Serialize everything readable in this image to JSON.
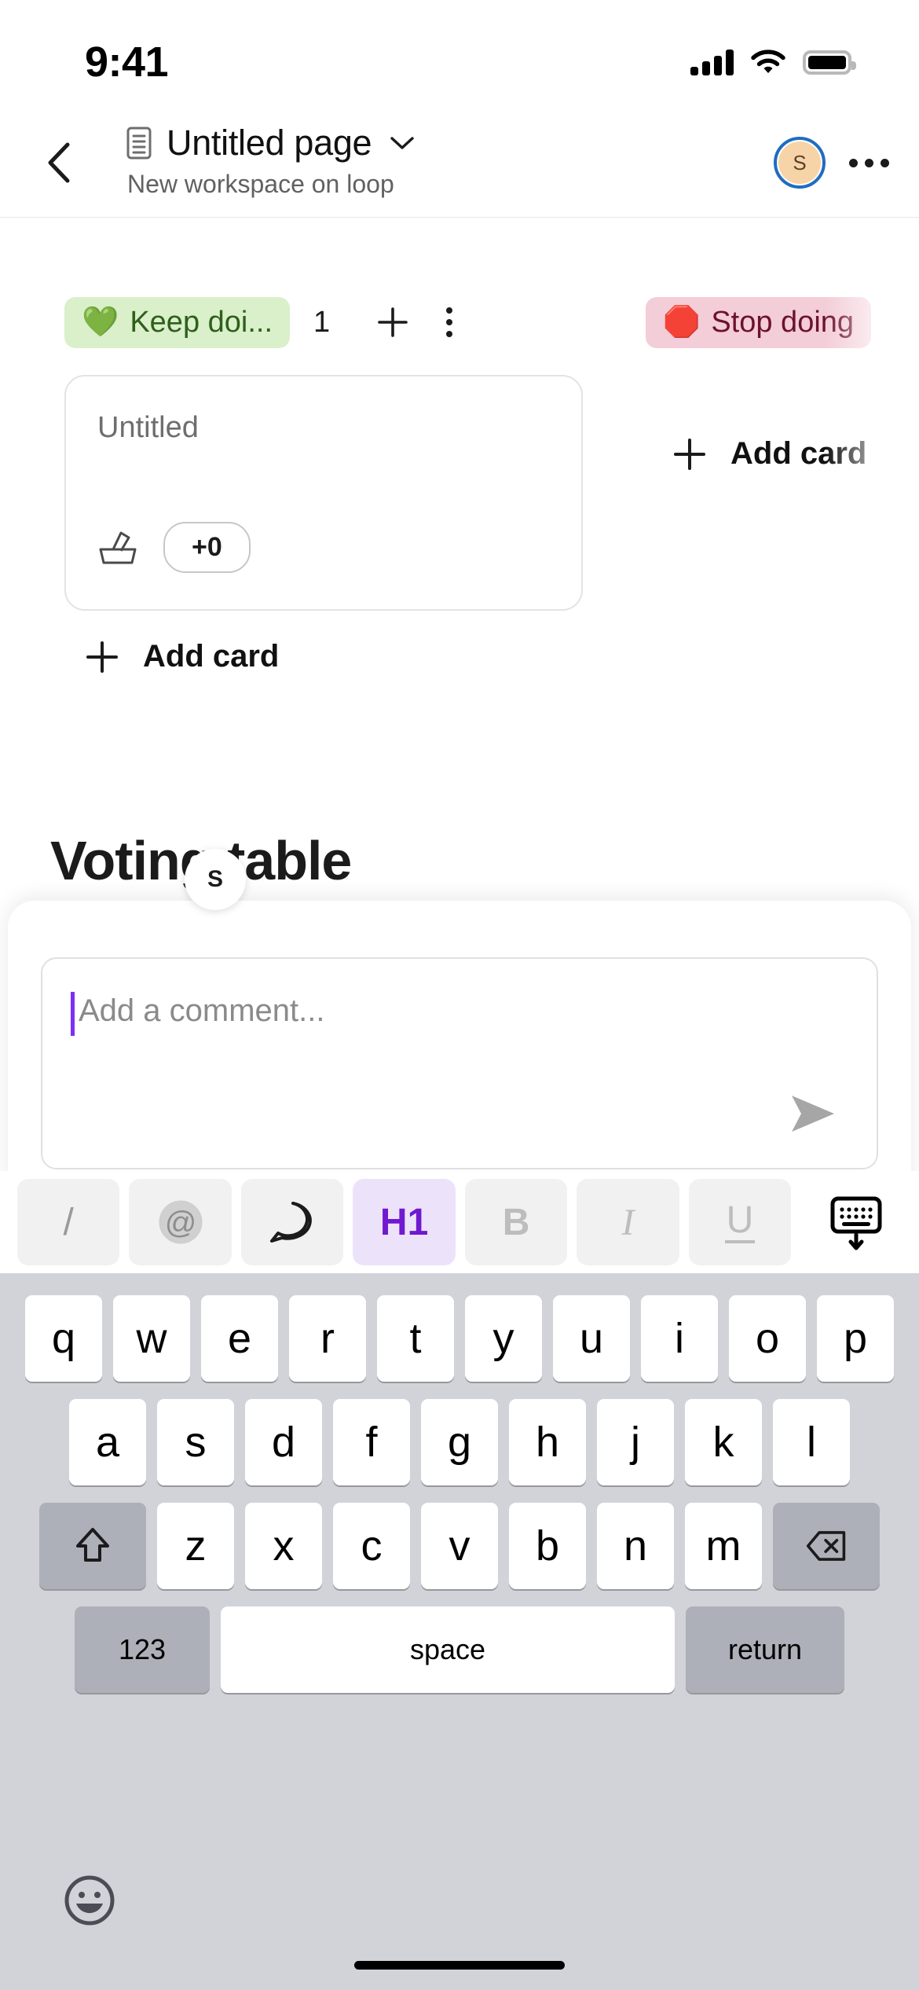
{
  "status_bar": {
    "time": "9:41",
    "signal_icon": "cellular-signal-icon",
    "wifi_icon": "wifi-icon",
    "battery_icon": "battery-icon"
  },
  "nav": {
    "back_icon": "chevron-left-icon",
    "doc_icon": "document-icon",
    "title": "Untitled page",
    "title_chevron_icon": "chevron-down-icon",
    "subtitle": "New workspace on loop",
    "avatar_initial": "S",
    "avatar_bg": "#f7d4a8",
    "avatar_ring": "#1f6dc0",
    "overflow_icon": "more-options-icon"
  },
  "board": {
    "columns": [
      {
        "emoji": "💚",
        "label": "Keep doi...",
        "count": "1",
        "chip_bg": "#d9f0cb",
        "chip_fg": "#2f5f1a",
        "add_icon": "plus-icon",
        "menu_icon": "more-vertical-icon",
        "card": {
          "title": "Untitled",
          "vote_icon": "ballot-box-icon",
          "vote_count": "+0"
        },
        "add_card_label": "Add card",
        "add_card_icon": "plus-icon"
      },
      {
        "emoji": "🛑",
        "label": "Stop doing",
        "chip_bg": "#f3cdd8",
        "chip_fg": "#6e1030",
        "add_card_label": "Add card",
        "add_card_icon": "plus-icon"
      }
    ]
  },
  "page": {
    "heading": "Voting table"
  },
  "comment_sheet": {
    "presence_initial": "S",
    "placeholder": "Add a comment...",
    "value": "",
    "caret_color": "#7b2ff7",
    "send_icon": "send-icon"
  },
  "format_toolbar": {
    "buttons": [
      {
        "name": "slash-command-button",
        "glyph": "/",
        "kind": "slash",
        "active": false
      },
      {
        "name": "mention-button",
        "glyph": "@",
        "kind": "mention",
        "active": false
      },
      {
        "name": "comment-button",
        "glyph": "",
        "kind": "comment",
        "active": false
      },
      {
        "name": "heading-one-button",
        "glyph": "H1",
        "kind": "h1",
        "active": true
      },
      {
        "name": "bold-button",
        "glyph": "B",
        "kind": "bold",
        "active": false
      },
      {
        "name": "italic-button",
        "glyph": "I",
        "kind": "italic",
        "active": false
      },
      {
        "name": "underline-button",
        "glyph": "U",
        "kind": "underline",
        "active": false
      }
    ],
    "dismiss_icon": "hide-keyboard-icon"
  },
  "keyboard": {
    "row1": [
      "q",
      "w",
      "e",
      "r",
      "t",
      "y",
      "u",
      "i",
      "o",
      "p"
    ],
    "row2": [
      "a",
      "s",
      "d",
      "f",
      "g",
      "h",
      "j",
      "k",
      "l"
    ],
    "row3": [
      "z",
      "x",
      "c",
      "v",
      "b",
      "n",
      "m"
    ],
    "shift_icon": "shift-icon",
    "backspace_icon": "backspace-icon",
    "numeric_label": "123",
    "space_label": "space",
    "return_label": "return",
    "emoji_icon": "emoji-icon",
    "bg": "#d1d3d9",
    "key_bg": "#ffffff",
    "mod_bg": "#adb0b9"
  }
}
